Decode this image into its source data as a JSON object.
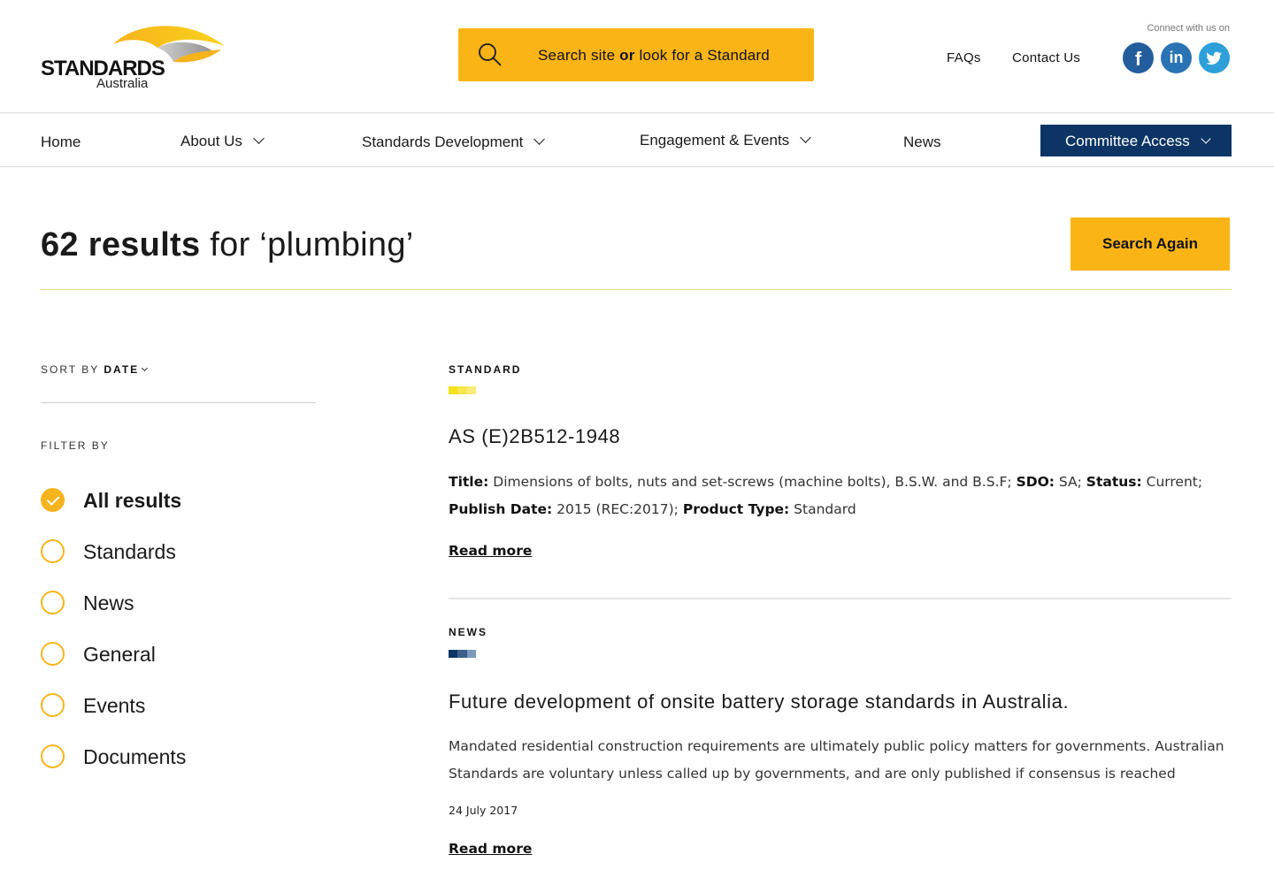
{
  "header": {
    "logo": {
      "word": "STANDARDS",
      "sub": "Australia"
    },
    "search": {
      "prefix": "Search site ",
      "or": "or",
      "suffix": " look for a Standard",
      "icon": "search-icon"
    },
    "links": {
      "faqs": "FAQs",
      "contact": "Contact Us"
    },
    "connect_label": "Connect with us on",
    "social": [
      {
        "name": "facebook-icon",
        "glyph": "f",
        "color": "#235d9c"
      },
      {
        "name": "linkedin-icon",
        "glyph": "in",
        "color": "#2a73b4"
      },
      {
        "name": "twitter-icon",
        "glyph": "twitter",
        "color": "#2d9fd9"
      }
    ]
  },
  "nav": {
    "home": "Home",
    "about": "About Us",
    "development": "Standards Development",
    "engagement": "Engagement & Events",
    "news": "News",
    "committee": "Committee Access"
  },
  "results_header": {
    "count": "62 results",
    "query": " for ‘plumbing’",
    "search_again": "Search Again"
  },
  "sidebar": {
    "sort_prefix": "SORT BY",
    "sort_value": "DATE",
    "filter_label": "FILTER BY",
    "filters": [
      {
        "label": "All results",
        "checked": true
      },
      {
        "label": "Standards",
        "checked": false
      },
      {
        "label": "News",
        "checked": false
      },
      {
        "label": "General",
        "checked": false
      },
      {
        "label": "Events",
        "checked": false
      },
      {
        "label": "Documents",
        "checked": false
      }
    ]
  },
  "results": [
    {
      "type": "STANDARD",
      "swatch_colors": [
        "#f7e11c",
        "#f7e64a",
        "#f9ea7a"
      ],
      "title": "AS (E)2B512-1948",
      "fields": {
        "title_label": "Title:",
        "title_value": " Dimensions of bolts, nuts and set-screws (machine bolts), B.S.W. and B.S.F; ",
        "sdo_label": "SDO:",
        "sdo_value": " SA; ",
        "status_label": "Status:",
        "status_value": " Current;",
        "publish_label": "Publish Date:",
        "publish_value": " 2015 (REC:2017); ",
        "product_label": "Product Type:",
        "product_value": " Standard"
      },
      "read_more": "Read more"
    },
    {
      "type": "NEWS",
      "swatch_colors": [
        "#0c3566",
        "#3a5f8c",
        "#7a9abc"
      ],
      "title": "Future development of onsite battery storage standards in Australia.",
      "body": "Mandated residential construction requirements are ultimately public policy matters for governments. Australian Standards are voluntary unless called up by governments, and are only published if consensus is reached",
      "date": "24 July 2017",
      "read_more": "Read more"
    }
  ],
  "colors": {
    "accent": "#fbb416",
    "navy": "#0c3566"
  }
}
